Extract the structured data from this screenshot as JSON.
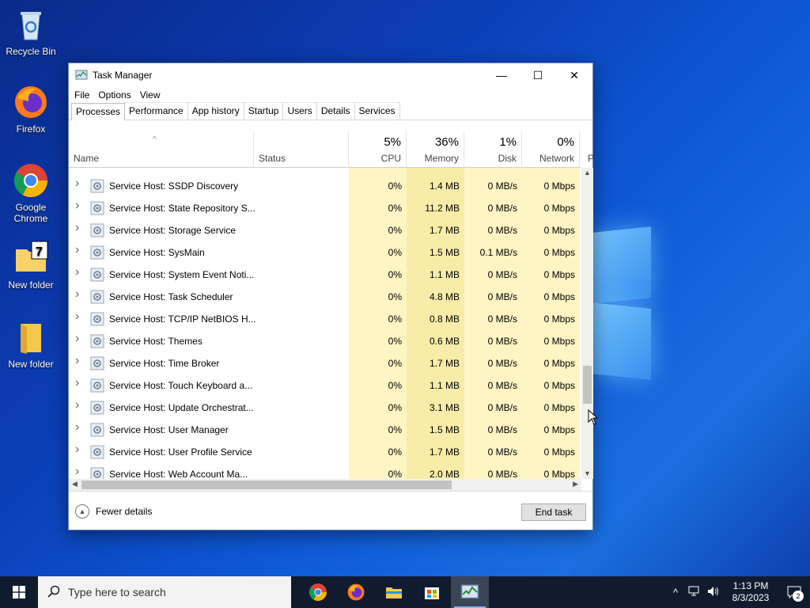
{
  "desktop": {
    "icons": [
      {
        "label": "Recycle Bin"
      },
      {
        "label": "Firefox"
      },
      {
        "label": "Google Chrome"
      },
      {
        "label": "New folder"
      },
      {
        "label": "New folder"
      }
    ]
  },
  "window": {
    "title": "Task Manager",
    "controls": {
      "minimize": "—",
      "maximize": "☐",
      "close": "✕"
    },
    "menu": [
      "File",
      "Options",
      "View"
    ],
    "tabs": [
      "Processes",
      "Performance",
      "App history",
      "Startup",
      "Users",
      "Details",
      "Services"
    ],
    "active_tab": "Processes"
  },
  "columns": {
    "name": "Name",
    "status": "Status",
    "cpu": {
      "pct": "5%",
      "label": "CPU"
    },
    "memory": {
      "pct": "36%",
      "label": "Memory"
    },
    "disk": {
      "pct": "1%",
      "label": "Disk"
    },
    "network": {
      "pct": "0%",
      "label": "Network"
    },
    "power_partial": "P"
  },
  "processes": [
    {
      "name": "Service Host: SSDP Discovery",
      "cpu": "0%",
      "memory": "1.4 MB",
      "disk": "0 MB/s",
      "network": "0 Mbps"
    },
    {
      "name": "Service Host: State Repository S...",
      "cpu": "0%",
      "memory": "11.2 MB",
      "disk": "0 MB/s",
      "network": "0 Mbps"
    },
    {
      "name": "Service Host: Storage Service",
      "cpu": "0%",
      "memory": "1.7 MB",
      "disk": "0 MB/s",
      "network": "0 Mbps"
    },
    {
      "name": "Service Host: SysMain",
      "cpu": "0%",
      "memory": "1.5 MB",
      "disk": "0.1 MB/s",
      "network": "0 Mbps"
    },
    {
      "name": "Service Host: System Event Noti...",
      "cpu": "0%",
      "memory": "1.1 MB",
      "disk": "0 MB/s",
      "network": "0 Mbps"
    },
    {
      "name": "Service Host: Task Scheduler",
      "cpu": "0%",
      "memory": "4.8 MB",
      "disk": "0 MB/s",
      "network": "0 Mbps"
    },
    {
      "name": "Service Host: TCP/IP NetBIOS H...",
      "cpu": "0%",
      "memory": "0.8 MB",
      "disk": "0 MB/s",
      "network": "0 Mbps"
    },
    {
      "name": "Service Host: Themes",
      "cpu": "0%",
      "memory": "0.6 MB",
      "disk": "0 MB/s",
      "network": "0 Mbps"
    },
    {
      "name": "Service Host: Time Broker",
      "cpu": "0%",
      "memory": "1.7 MB",
      "disk": "0 MB/s",
      "network": "0 Mbps"
    },
    {
      "name": "Service Host: Touch Keyboard a...",
      "cpu": "0%",
      "memory": "1.1 MB",
      "disk": "0 MB/s",
      "network": "0 Mbps"
    },
    {
      "name": "Service Host: Update Orchestrat...",
      "cpu": "0%",
      "memory": "3.1 MB",
      "disk": "0 MB/s",
      "network": "0 Mbps"
    },
    {
      "name": "Service Host: User Manager",
      "cpu": "0%",
      "memory": "1.5 MB",
      "disk": "0 MB/s",
      "network": "0 Mbps"
    },
    {
      "name": "Service Host: User Profile Service",
      "cpu": "0%",
      "memory": "1.7 MB",
      "disk": "0 MB/s",
      "network": "0 Mbps"
    },
    {
      "name": "Service Host: Web Account Ma...",
      "cpu": "0%",
      "memory": "2.0 MB",
      "disk": "0 MB/s",
      "network": "0 Mbps"
    }
  ],
  "footer": {
    "fewer_details": "Fewer details",
    "end_task": "End task"
  },
  "taskbar": {
    "search_placeholder": "Type here to search",
    "apps": [
      "chrome-icon",
      "firefox-icon",
      "file-explorer-icon",
      "store-icon",
      "task-manager-icon"
    ],
    "time": "1:13 PM",
    "date": "8/3/2023",
    "notification_count": "2"
  },
  "colors": {
    "heat_light": "#fff4c4",
    "heat_medium": "#f9eca8",
    "taskbar": "#101c2e"
  }
}
